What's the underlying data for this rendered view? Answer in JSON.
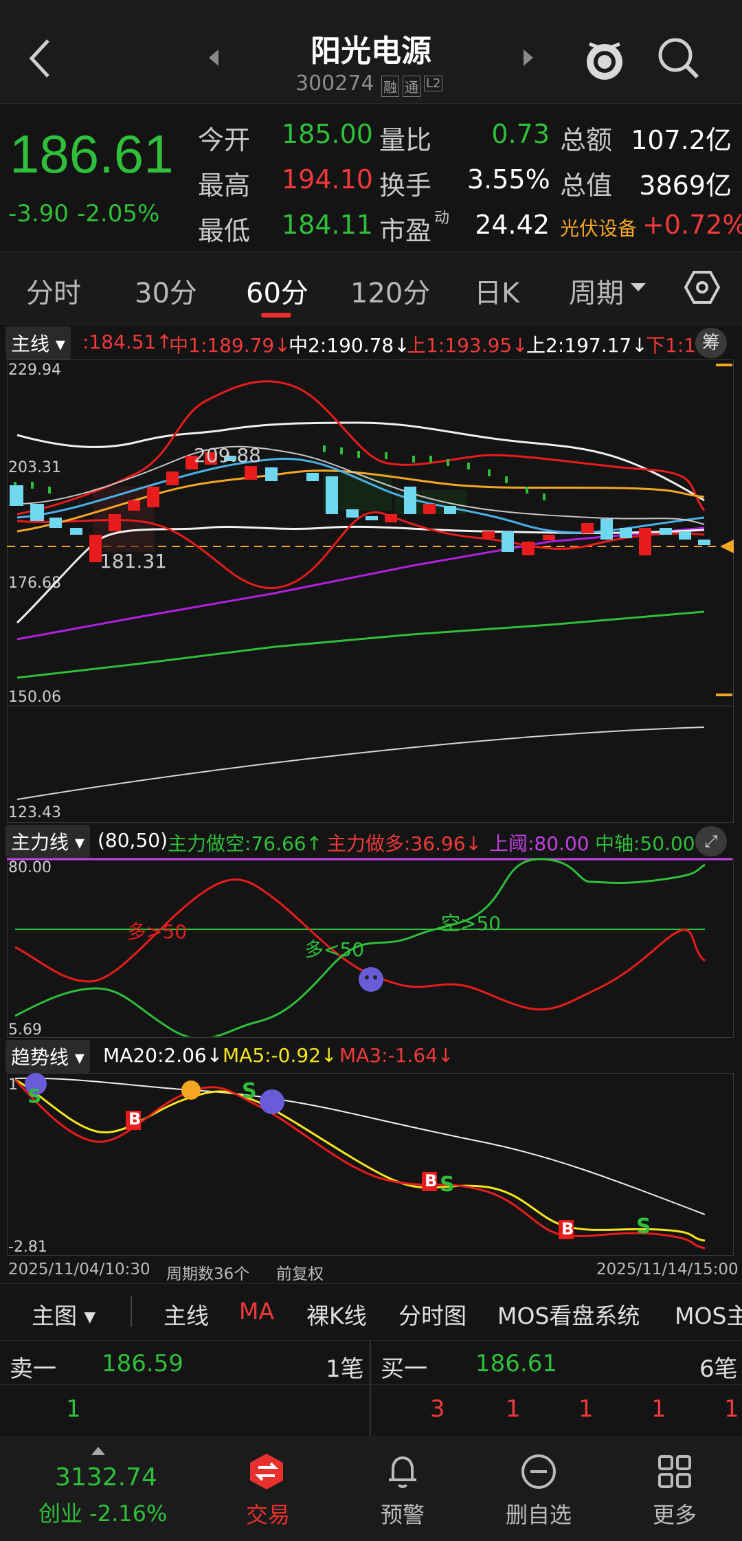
{
  "header": {
    "title": "阳光电源",
    "code": "300274",
    "badge1": "融",
    "badge2": "通",
    "badge3": "L2"
  },
  "quote": {
    "price": "186.61",
    "change": "-3.90",
    "change_pct": "-2.05%",
    "rows": [
      {
        "l1": "今开",
        "v1": "185.00",
        "l2": "量比",
        "v2": "0.73",
        "l3": "总额",
        "v3": "107.2亿"
      },
      {
        "l1": "最高",
        "v1": "194.10",
        "l2": "换手",
        "v2": "3.55%",
        "l3": "总值",
        "v3": "3869亿"
      },
      {
        "l1": "最低",
        "v1": "184.11",
        "l2": "市盈",
        "l2sup": "动",
        "v2": "24.42",
        "l3": "光伏设备",
        "v3": "+0.72%"
      }
    ]
  },
  "periods": [
    "分时",
    "30分",
    "60分",
    "120分",
    "日K",
    "周期"
  ],
  "active_period": "60分",
  "main_indicator": {
    "tag": "主线",
    "items": [
      {
        "text": ":184.51↑",
        "color": "#f03a3a"
      },
      {
        "text": "中1:189.79↓",
        "color": "#f03a3a"
      },
      {
        "text": "中2:190.78↓",
        "color": "#ffffff"
      },
      {
        "text": "上1:193.95↓",
        "color": "#f03a3a"
      },
      {
        "text": "上2:197.17↓",
        "color": "#ffffff"
      },
      {
        "text": "下1:1",
        "color": "#f03a3a"
      }
    ],
    "right_btn": "筹"
  },
  "main_axis": {
    "top": "229.94",
    "mid": "203.31",
    "low": "176.68",
    "bottom": "150.06",
    "vol_bottom": "123.43"
  },
  "price_annotations": {
    "high": "209.88",
    "low": "181.31"
  },
  "force_indicator": {
    "tag": "主力线",
    "params": "(80,50)",
    "items": [
      {
        "text": "主力做空:76.66↑",
        "color": "#2fbf3a"
      },
      {
        "text": "主力做多:36.96↓",
        "color": "#f03a3a"
      },
      {
        "text": "上阈:80.00",
        "color": "#c040e0"
      },
      {
        "text": "中轴:50.00",
        "color": "#2fbf3a"
      }
    ],
    "axis_top": "80.00",
    "axis_bottom": "5.69",
    "labels": {
      "duo_gt": "多>50",
      "duo_lt": "多<50",
      "kong_gt": "空>50"
    }
  },
  "trend_indicator": {
    "tag": "趋势线",
    "items": [
      {
        "text": "MA20:2.06↓",
        "color": "#ffffff"
      },
      {
        "text": "MA5:-0.92↓",
        "color": "#f5e61e"
      },
      {
        "text": "MA3:-1.64↓",
        "color": "#f03a3a"
      }
    ],
    "axis_top": "1",
    "axis_bottom": "-2.81",
    "marks": {
      "buy": "B",
      "sell": "S"
    }
  },
  "footer_info": {
    "start": "2025/11/04/10:30",
    "count": "周期数36个",
    "adjust": "前复权",
    "end": "2025/11/14/15:00"
  },
  "main_bar": [
    "主图",
    "主线",
    "MA",
    "裸K线",
    "分时图",
    "MOS看盘系统",
    "MOS主"
  ],
  "order_book": {
    "sell_label": "卖一",
    "sell_price": "186.59",
    "sell_count": "1笔",
    "buy_label": "买一",
    "buy_price": "186.61",
    "buy_count": "6笔",
    "sell_detail": [
      "1"
    ],
    "buy_detail": [
      "3",
      "1",
      "1",
      "1",
      "1"
    ]
  },
  "bottom_nav": {
    "index_value": "3132.74",
    "index_name": "创业 -2.16%",
    "items": [
      "交易",
      "预警",
      "删自选",
      "更多"
    ]
  },
  "colors": {
    "up": "#f03a3a",
    "down": "#2fbf3a",
    "accent": "#e8302e",
    "orange": "#f5a623"
  }
}
